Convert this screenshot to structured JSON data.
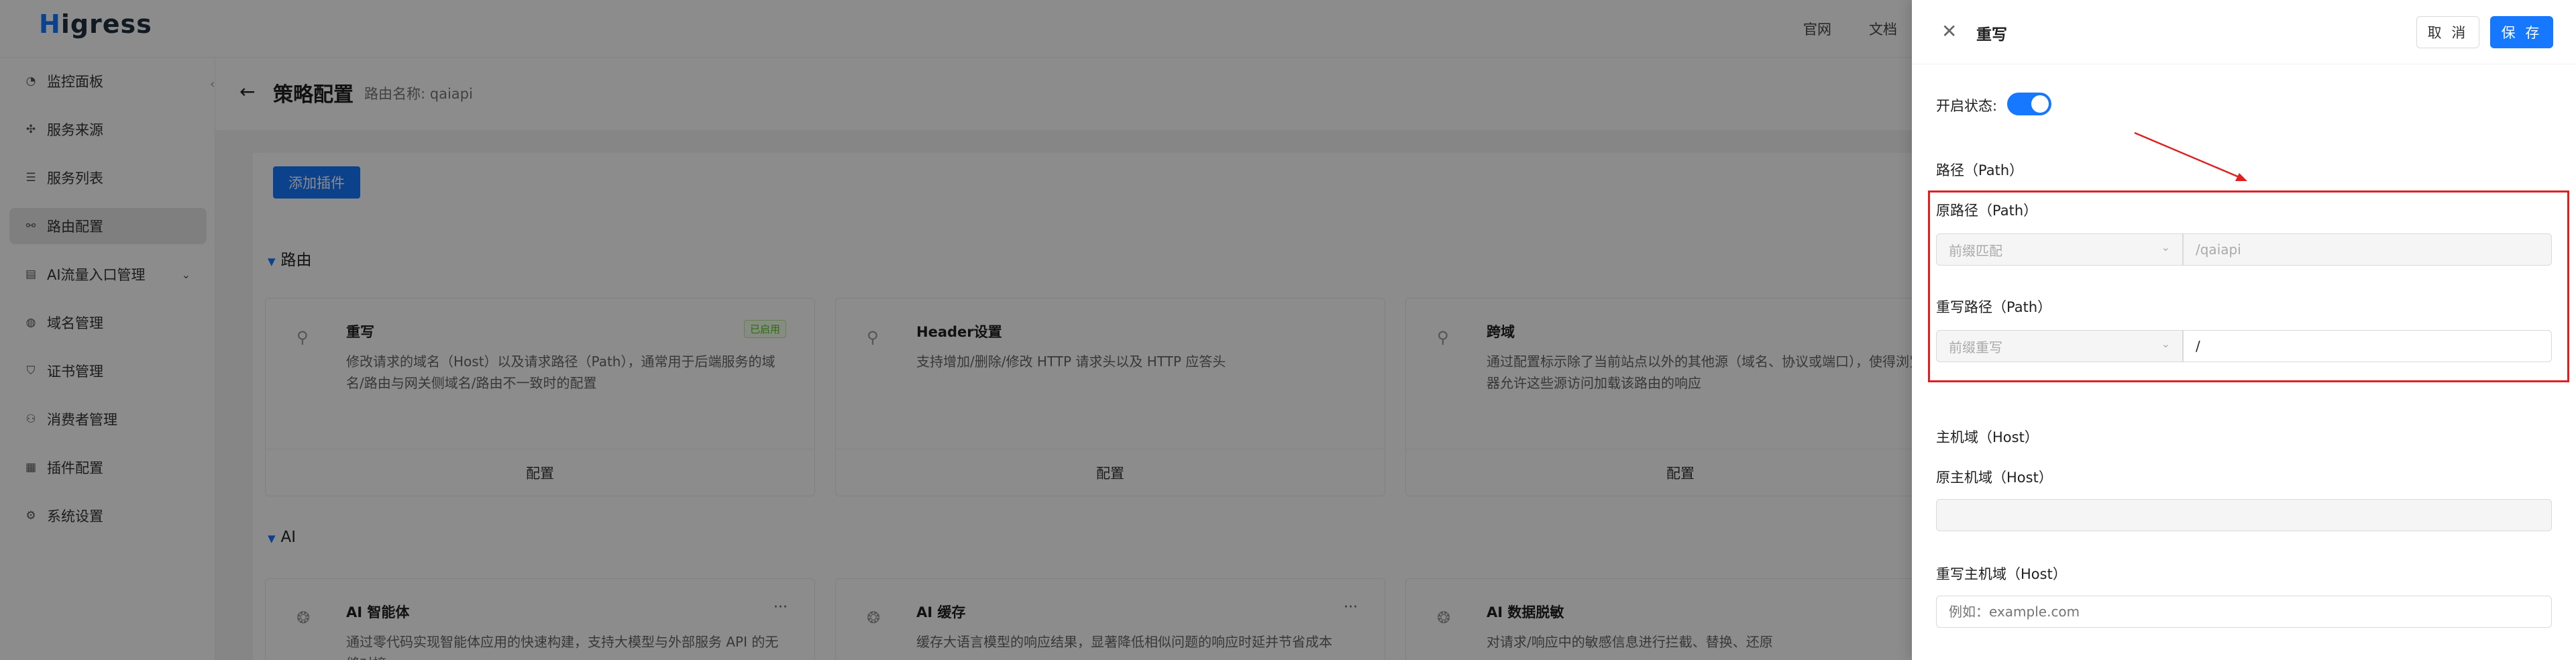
{
  "app": {
    "logo_rest": "igress",
    "logo_h": "H"
  },
  "topnav": {
    "item1": "官网",
    "item2": "文档"
  },
  "sidebar": {
    "items": [
      {
        "label": "监控面板",
        "icon": "dashboard-icon",
        "glyph": "◔"
      },
      {
        "label": "服务来源",
        "icon": "source-icon",
        "glyph": "✣"
      },
      {
        "label": "服务列表",
        "icon": "list-icon",
        "glyph": "☰"
      },
      {
        "label": "路由配置",
        "icon": "route-icon",
        "glyph": "⚯"
      },
      {
        "label": "AI流量入口管理",
        "icon": "ai-gateway-icon",
        "glyph": "▤"
      },
      {
        "label": "域名管理",
        "icon": "globe-icon",
        "glyph": "◍"
      },
      {
        "label": "证书管理",
        "icon": "shield-icon",
        "glyph": "⛉"
      },
      {
        "label": "消费者管理",
        "icon": "user-icon",
        "glyph": "⚇"
      },
      {
        "label": "插件配置",
        "icon": "plugin-icon",
        "glyph": "▦"
      },
      {
        "label": "系统设置",
        "icon": "gear-icon",
        "glyph": "⚙"
      }
    ]
  },
  "page": {
    "title": "策略配置",
    "route_label": "路由名称: qaiapi",
    "add_plugin": "添加插件"
  },
  "sections": {
    "route": "路由",
    "ai": "AI"
  },
  "cards_route": [
    {
      "title": "重写",
      "desc": "修改请求的域名（Host）以及请求路径（Path），通常用于后端服务的域名/路由与网关侧域名/路由不一致时的配置",
      "badge": "已启用",
      "footer": "配置"
    },
    {
      "title": "Header设置",
      "desc": "支持增加/删除/修改 HTTP 请求头以及 HTTP 应答头",
      "footer": "配置"
    },
    {
      "title": "跨域",
      "desc": "通过配置标示除了当前站点以外的其他源（域名、协议或端口），使得浏览器允许这些源访问加载该路由的响应",
      "footer": "配置"
    }
  ],
  "cards_ai": [
    {
      "title": "AI 智能体",
      "desc": "通过零代码实现智能体应用的快速构建，支持大模型与外部服务 API 的无缝对接"
    },
    {
      "title": "AI 缓存",
      "desc": "缓存大语言模型的响应结果，显著降低相似问题的响应时延并节省成本"
    },
    {
      "title": "AI 数据脱敏",
      "desc": "对请求/响应中的敏感信息进行拦截、替换、还原"
    }
  ],
  "drawer": {
    "title": "重写",
    "cancel": "取 消",
    "save": "保 存",
    "enable_label": "开启状态:",
    "enabled": true,
    "path_section": "路径（Path）",
    "orig_path_label": "原路径（Path）",
    "orig_path_match": "前缀匹配",
    "orig_path_value": "/qaiapi",
    "rewrite_path_label": "重写路径（Path）",
    "rewrite_path_match": "前缀重写",
    "rewrite_path_value": "/",
    "host_section": "主机域（Host）",
    "orig_host_label": "原主机域（Host）",
    "orig_host_value": "",
    "rewrite_host_label": "重写主机域（Host）",
    "rewrite_host_placeholder": "例如：example.com"
  },
  "colors": {
    "accent": "#1677ff",
    "annotation": "#e02020",
    "badge": "#52c41a"
  }
}
